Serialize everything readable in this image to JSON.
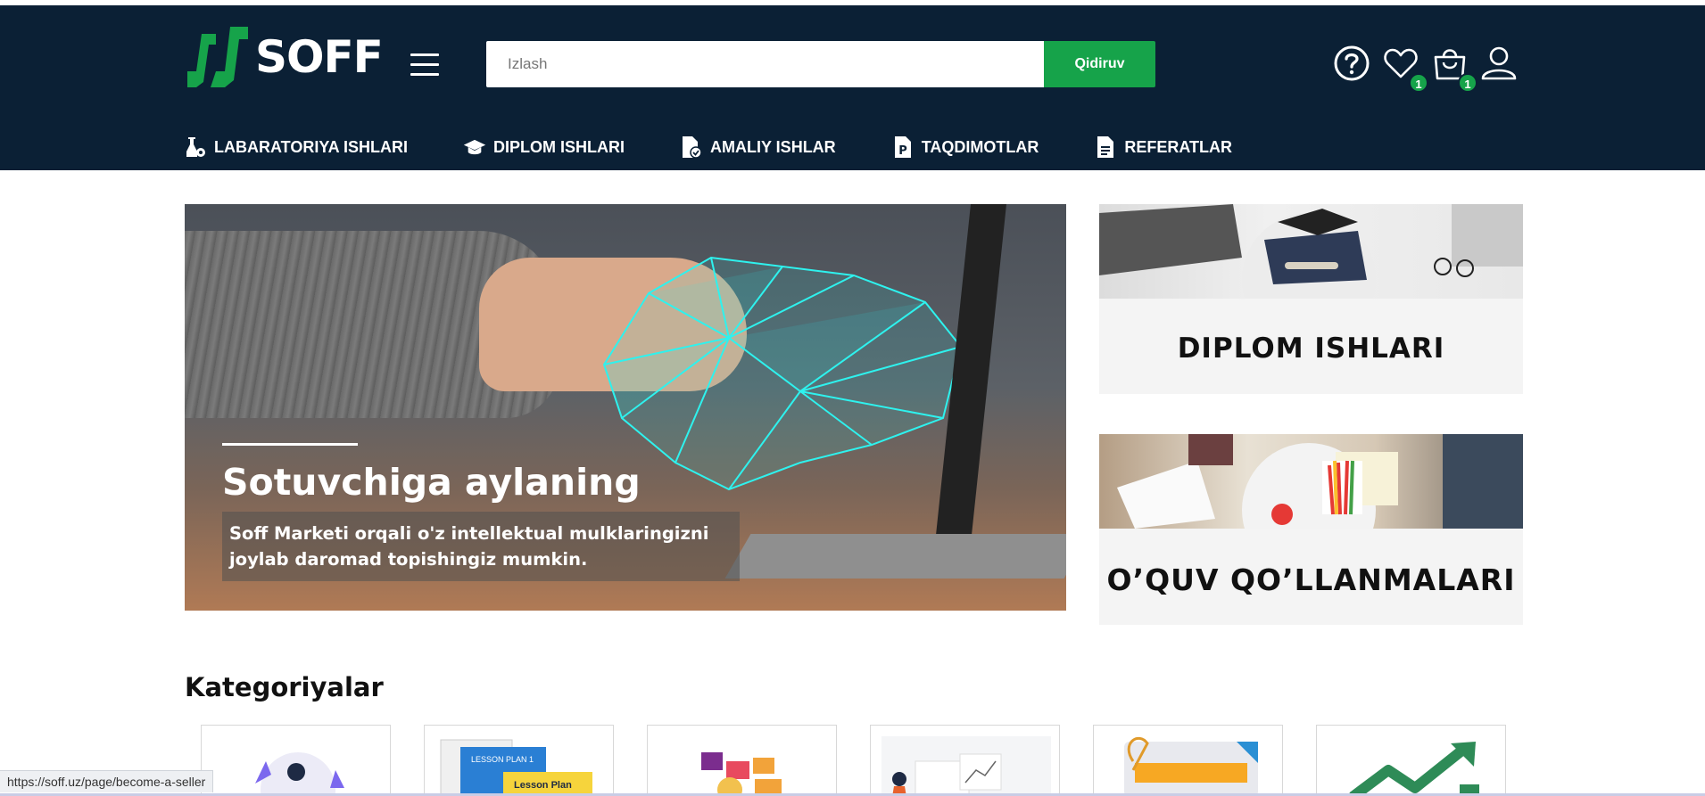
{
  "header": {
    "logo_text": "SOFF",
    "search": {
      "placeholder": "Izlash",
      "button_label": "Qidiruv"
    },
    "icons": [
      {
        "name": "help-icon",
        "badge": ""
      },
      {
        "name": "heart-icon",
        "badge": "1"
      },
      {
        "name": "shopping-bag-icon",
        "badge": "1"
      },
      {
        "name": "user-icon",
        "badge": ""
      }
    ]
  },
  "nav": {
    "items": [
      {
        "label": "LABARATORIYA ISHLARI",
        "icon": "lab-gear-icon"
      },
      {
        "label": "DIPLOM ISHLARI",
        "icon": "graduation-cap-icon"
      },
      {
        "label": "AMALIY ISHLAR",
        "icon": "document-check-icon"
      },
      {
        "label": "TAQDIMOTLAR",
        "icon": "presentation-file-icon"
      },
      {
        "label": "REFERATLAR",
        "icon": "file-text-icon"
      }
    ]
  },
  "hero": {
    "title": "Sotuvchiga aylaning",
    "description": "Soff Marketi orqali o'z intellektual mulklaringizni joylab daromad topishingiz mumkin."
  },
  "promos": [
    {
      "title": "DIPLOM ISHLARI"
    },
    {
      "title": "O’QUV QO’LLANMALARI"
    }
  ],
  "categories": {
    "title": "Kategoriyalar",
    "cards": [
      "lab-illustration",
      "lesson-plan-illustration",
      "presentation-illustration",
      "report-illustration",
      "clipboard-illustration",
      "growth-chart-illustration"
    ]
  },
  "statusbar": {
    "url": "https://soff.uz/page/become-a-seller"
  },
  "colors": {
    "header_bg": "#0b2035",
    "accent_green": "#16a34a"
  }
}
